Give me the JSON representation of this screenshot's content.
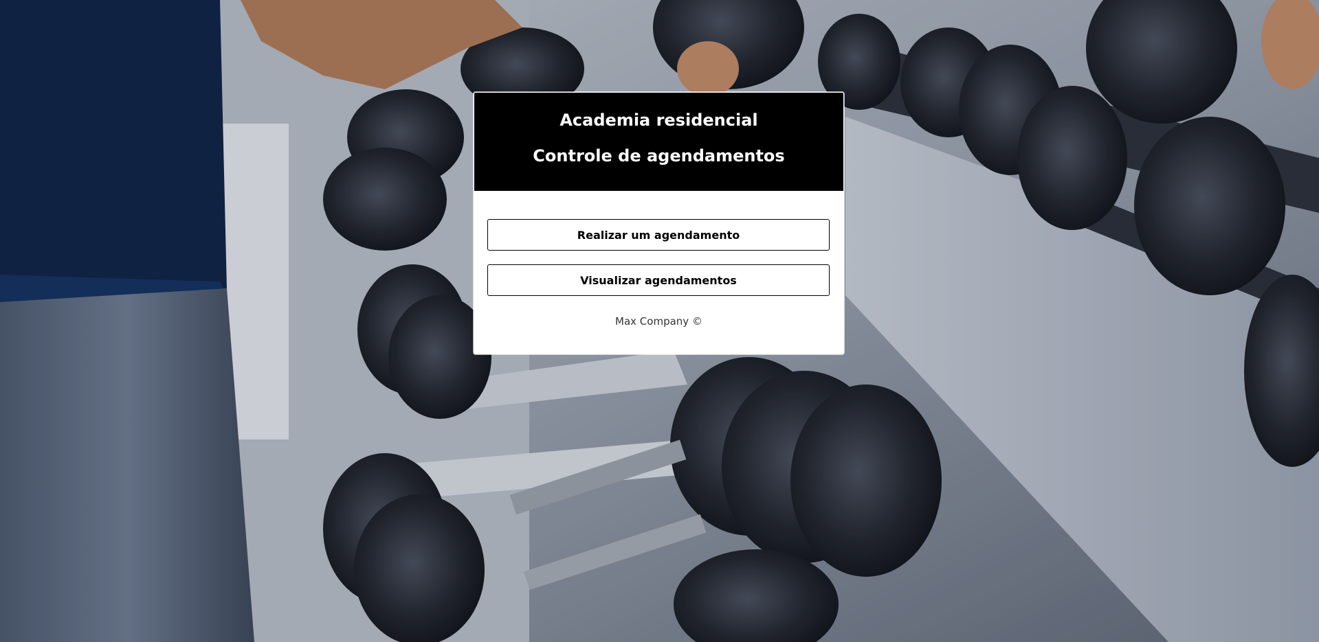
{
  "background": {
    "scene": "gym-dumbbell-rack-photo"
  },
  "card": {
    "title": "Academia residencial",
    "subtitle": "Controle de agendamentos",
    "buttons": [
      {
        "label": "Realizar um agendamento"
      },
      {
        "label": "Visualizar agendamentos"
      }
    ],
    "footer": "Max Company ©"
  },
  "colors": {
    "header_bg": "#000000",
    "header_text": "#ffffff",
    "button_border": "#000000"
  }
}
